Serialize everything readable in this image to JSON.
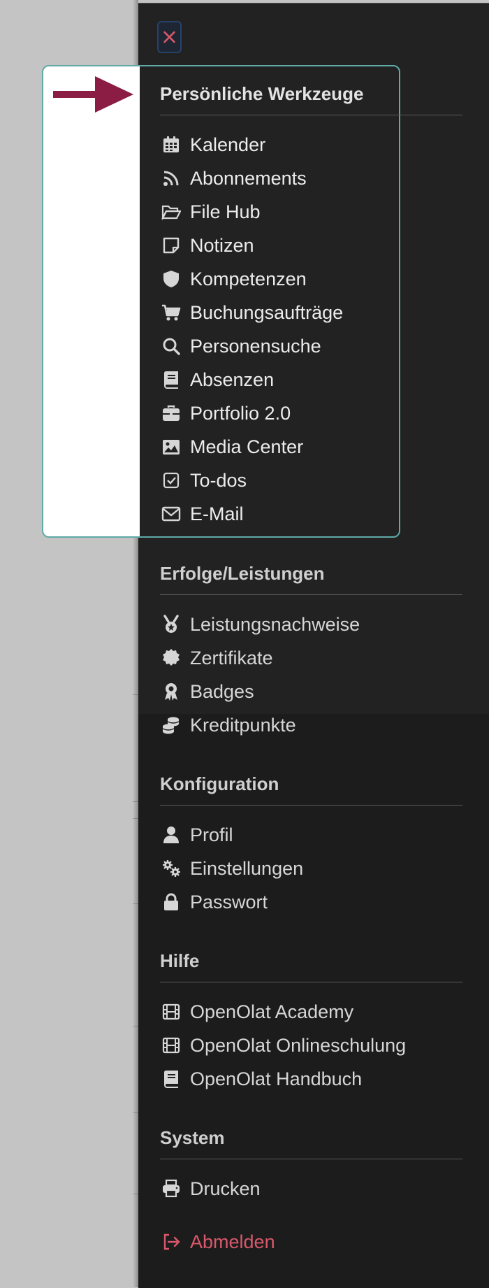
{
  "menu": {
    "close_icon": "close-icon",
    "sections": [
      {
        "title": "Persönliche Werkzeuge",
        "items": [
          {
            "label": "Kalender",
            "icon": "calendar-icon"
          },
          {
            "label": "Abonnements",
            "icon": "rss-icon"
          },
          {
            "label": "File Hub",
            "icon": "folder-open-icon"
          },
          {
            "label": "Notizen",
            "icon": "note-icon"
          },
          {
            "label": "Kompetenzen",
            "icon": "shield-icon"
          },
          {
            "label": "Buchungsaufträge",
            "icon": "cart-icon"
          },
          {
            "label": "Personensuche",
            "icon": "search-icon"
          },
          {
            "label": "Absenzen",
            "icon": "book-icon"
          },
          {
            "label": "Portfolio 2.0",
            "icon": "briefcase-icon"
          },
          {
            "label": "Media Center",
            "icon": "image-icon"
          },
          {
            "label": "To-dos",
            "icon": "checkbox-icon"
          },
          {
            "label": "E-Mail",
            "icon": "envelope-icon"
          }
        ]
      },
      {
        "title": "Erfolge/Leistungen",
        "items": [
          {
            "label": "Leistungsnachweise",
            "icon": "medal-icon"
          },
          {
            "label": "Zertifikate",
            "icon": "certificate-icon"
          },
          {
            "label": "Badges",
            "icon": "award-icon"
          },
          {
            "label": "Kreditpunkte",
            "icon": "coins-icon"
          }
        ]
      },
      {
        "title": "Konfiguration",
        "items": [
          {
            "label": "Profil",
            "icon": "user-icon"
          },
          {
            "label": "Einstellungen",
            "icon": "gears-icon"
          },
          {
            "label": "Passwort",
            "icon": "lock-icon"
          }
        ]
      },
      {
        "title": "Hilfe",
        "items": [
          {
            "label": "OpenOlat Academy",
            "icon": "film-icon"
          },
          {
            "label": "OpenOlat Onlineschulung",
            "icon": "film-icon"
          },
          {
            "label": "OpenOlat Handbuch",
            "icon": "book-icon"
          }
        ]
      },
      {
        "title": "System",
        "items": [
          {
            "label": "Drucken",
            "icon": "printer-icon"
          }
        ]
      }
    ],
    "logout": {
      "label": "Abmelden",
      "icon": "sign-out-icon"
    }
  },
  "colors": {
    "panel_background": "#1c1c1c",
    "highlight_border": "#5fa9a6",
    "arrow": "#8b1c43",
    "logout": "#d8596b"
  }
}
